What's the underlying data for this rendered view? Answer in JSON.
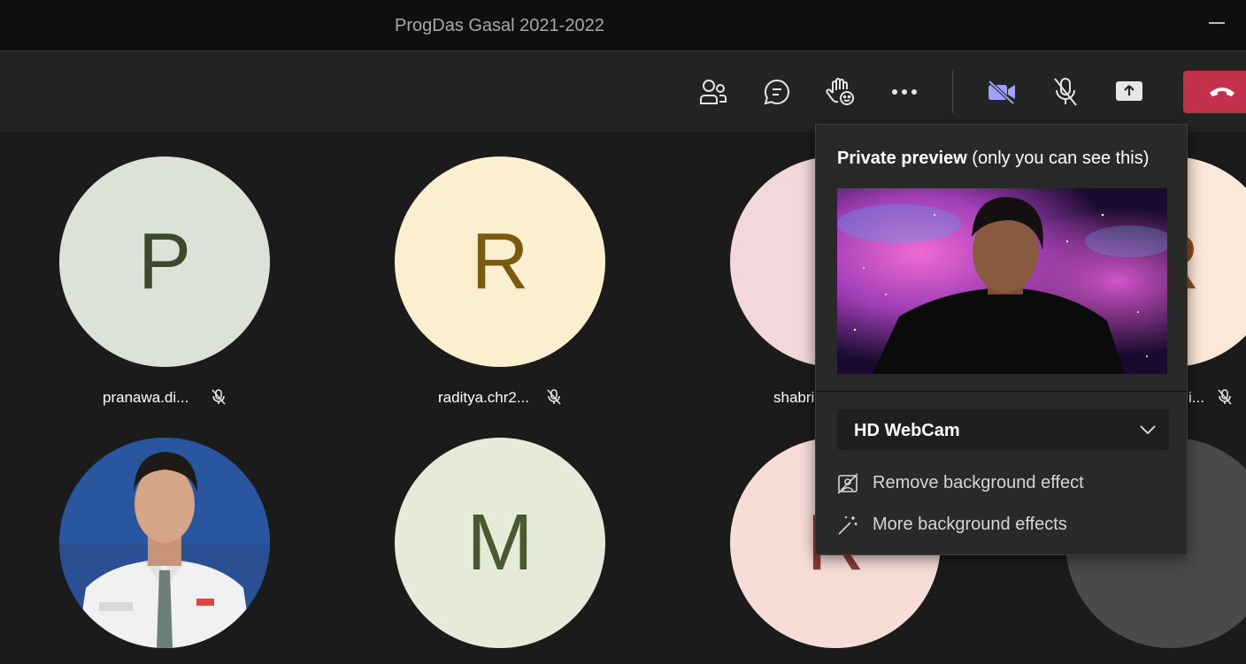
{
  "window": {
    "title": "ProgDas Gasal 2021-2022"
  },
  "toolbar": {
    "icons": [
      "people-icon",
      "chat-icon",
      "raise-hand-reactions-icon",
      "more-icon",
      "camera-off-icon",
      "mic-off-icon",
      "share-screen-icon",
      "hang-up-icon"
    ],
    "camera_color": "#9ea2ff",
    "hangup_color": "#c4314b"
  },
  "participants": [
    {
      "initial": "P",
      "name": "pranawa.di...",
      "bg": "#dde2d9",
      "fg": "#3b4a2a"
    },
    {
      "initial": "R",
      "name": "raditya.chr2...",
      "bg": "#fcefcf",
      "fg": "#7a5a0f"
    },
    {
      "initial": "",
      "name": "shabri",
      "bg": "#f3d8db",
      "fg": "#7b2e36"
    },
    {
      "initial": "R",
      "name": "i...",
      "bg": "#fce8d8",
      "fg": "#8a4b1f"
    },
    {
      "initial": "",
      "name": "",
      "bg": "#2e4d8c",
      "fg": "#ffffff"
    },
    {
      "initial": "M",
      "name": "",
      "bg": "#e5ead9",
      "fg": "#4a5a30"
    },
    {
      "initial": "R",
      "name": "",
      "bg": "#f8dcd8",
      "fg": "#8b3a2e"
    },
    {
      "initial": "",
      "name": "",
      "bg": "#4a4a4a",
      "fg": "#ffffff"
    }
  ],
  "popup": {
    "title_bold": "Private preview",
    "title_rest": " (only you can see this)",
    "camera": "HD WebCam",
    "remove_bg": "Remove background effect",
    "more_bg": "More background effects"
  }
}
